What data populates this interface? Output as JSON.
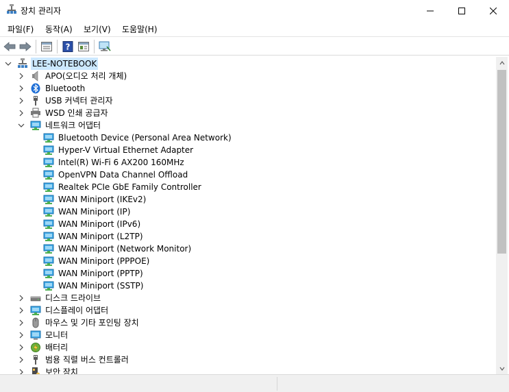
{
  "window": {
    "title": "장치 관리자"
  },
  "menu": [
    {
      "label": "파일(F)"
    },
    {
      "label": "동작(A)"
    },
    {
      "label": "보기(V)"
    },
    {
      "label": "도움말(H)"
    }
  ],
  "toolbar": {
    "buttons": [
      "back-arrow-icon",
      "forward-arrow-icon",
      "properties-icon",
      "help-icon",
      "driver-update-icon",
      "monitor-scan-icon"
    ]
  },
  "tree": {
    "root": "LEE-NOTEBOOK",
    "categories_top": [
      {
        "label": "APO(오디오 처리 개체)",
        "icon": "speaker-icon"
      },
      {
        "label": "Bluetooth",
        "icon": "bluetooth-icon"
      },
      {
        "label": "USB 커넥터 관리자",
        "icon": "usb-icon"
      },
      {
        "label": "WSD 인쇄 공급자",
        "icon": "printer-icon"
      }
    ],
    "network": {
      "label": "네트워크 어댑터",
      "children": [
        "Bluetooth Device (Personal Area Network)",
        "Hyper-V Virtual Ethernet Adapter",
        "Intel(R) Wi-Fi 6 AX200 160MHz",
        "OpenVPN Data Channel Offload",
        "Realtek PCIe GbE Family Controller",
        "WAN Miniport (IKEv2)",
        "WAN Miniport (IP)",
        "WAN Miniport (IPv6)",
        "WAN Miniport (L2TP)",
        "WAN Miniport (Network Monitor)",
        "WAN Miniport (PPPOE)",
        "WAN Miniport (PPTP)",
        "WAN Miniport (SSTP)"
      ]
    },
    "categories_bottom": [
      {
        "label": "디스크 드라이브",
        "icon": "disk-drive-icon"
      },
      {
        "label": "디스플레이 어댑터",
        "icon": "display-adapter-icon"
      },
      {
        "label": "마우스 및 기타 포인팅 장치",
        "icon": "mouse-icon"
      },
      {
        "label": "모니터",
        "icon": "monitor-icon"
      },
      {
        "label": "배터리",
        "icon": "battery-icon"
      },
      {
        "label": "범용 직렬 버스 컨트롤러",
        "icon": "usb-controller-icon"
      },
      {
        "label": "보안 장치",
        "icon": "security-device-icon"
      }
    ]
  },
  "colors": {
    "selection": "#cce8ff",
    "accent": "#0078d7"
  }
}
